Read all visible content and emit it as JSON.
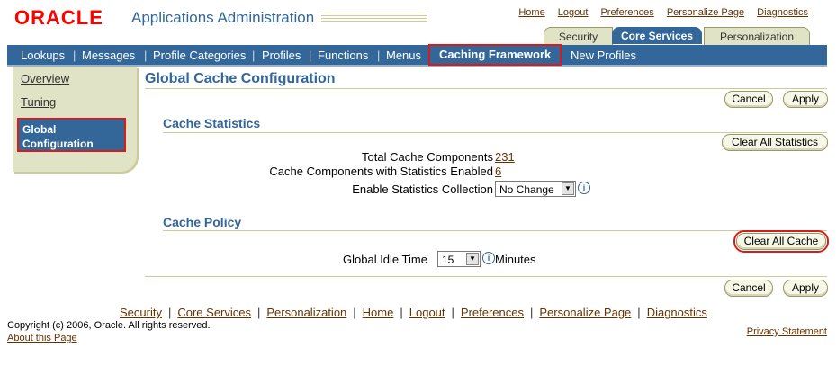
{
  "header": {
    "logo": "ORACLE",
    "title": "Applications Administration",
    "global_links": [
      "Home",
      "Logout",
      "Preferences",
      "Personalize Page",
      "Diagnostics"
    ]
  },
  "tabs": [
    {
      "label": "Security",
      "selected": false
    },
    {
      "label": "Core Services",
      "selected": true
    },
    {
      "label": "Personalization",
      "selected": false
    }
  ],
  "nav": {
    "items": [
      "Lookups",
      "Messages",
      "Profile Categories",
      "Profiles",
      "Functions",
      "Menus",
      "Caching Framework",
      "New Profiles"
    ],
    "selected": "Caching Framework"
  },
  "sidenav": {
    "overview": "Overview",
    "tuning": "Tuning",
    "global_line1": "Global",
    "global_line2": "Configuration"
  },
  "page": {
    "title": "Global Cache Configuration",
    "cancel": "Cancel",
    "apply": "Apply"
  },
  "stats": {
    "title": "Cache Statistics",
    "clear_button": "Clear All Statistics",
    "total_label": "Total Cache Components",
    "total_value": "231",
    "enabled_label": "Cache Components with Statistics Enabled",
    "enabled_value": "6",
    "collection_label": "Enable Statistics Collection",
    "collection_value": "No Change"
  },
  "policy": {
    "title": "Cache Policy",
    "clear_button": "Clear All Cache",
    "idle_label": "Global Idle Time",
    "idle_value": "15",
    "idle_unit": "Minutes"
  },
  "footer": {
    "links": [
      "Security",
      "Core Services",
      "Personalization",
      "Home",
      "Logout",
      "Preferences",
      "Personalize Page",
      "Diagnostics"
    ],
    "copyright": "Copyright (c) 2006, Oracle. All rights reserved.",
    "about": "About this Page",
    "privacy": "Privacy Statement"
  },
  "colors": {
    "brand_blue": "#336699",
    "tab_beige": "#e1e3c7",
    "link_brown": "#663300",
    "highlight_red": "#d81b1b"
  }
}
